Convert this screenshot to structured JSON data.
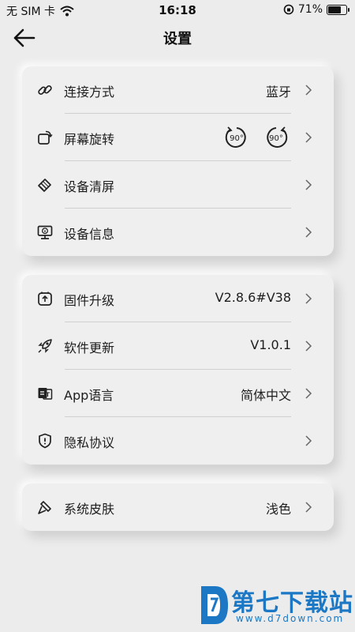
{
  "status_bar": {
    "carrier": "无 SIM 卡",
    "time": "16:18",
    "battery": "71%",
    "battery_level": 0.71
  },
  "nav": {
    "title": "设置",
    "back_icon": "arrow-left-icon"
  },
  "group1": [
    {
      "label": "连接方式",
      "value": "蓝牙",
      "icon": "link-icon"
    },
    {
      "label": "屏幕旋转",
      "value": "",
      "icon": "rotate-icon",
      "rotate_left_label": "90°",
      "rotate_right_label": "90°"
    },
    {
      "label": "设备清屏",
      "value": "",
      "icon": "eraser-icon"
    },
    {
      "label": "设备信息",
      "value": "",
      "icon": "monitor-info-icon"
    }
  ],
  "group2": [
    {
      "label": "固件升级",
      "value": "V2.8.6#V38",
      "icon": "firmware-upgrade-icon"
    },
    {
      "label": "软件更新",
      "value": "V1.0.1",
      "icon": "rocket-icon"
    },
    {
      "label": "App语言",
      "value": "简体中文",
      "icon": "language-icon"
    },
    {
      "label": "隐私协议",
      "value": "",
      "icon": "shield-icon"
    }
  ],
  "group3": [
    {
      "label": "系统皮肤",
      "value": "浅色",
      "icon": "brush-icon"
    }
  ],
  "watermark": {
    "name": "第七下载站",
    "url": "www.d7down.com"
  },
  "colors": {
    "background": "#ececec",
    "card": "#efefef",
    "text": "#1e1e1e",
    "watermark": "#1c78c4"
  }
}
